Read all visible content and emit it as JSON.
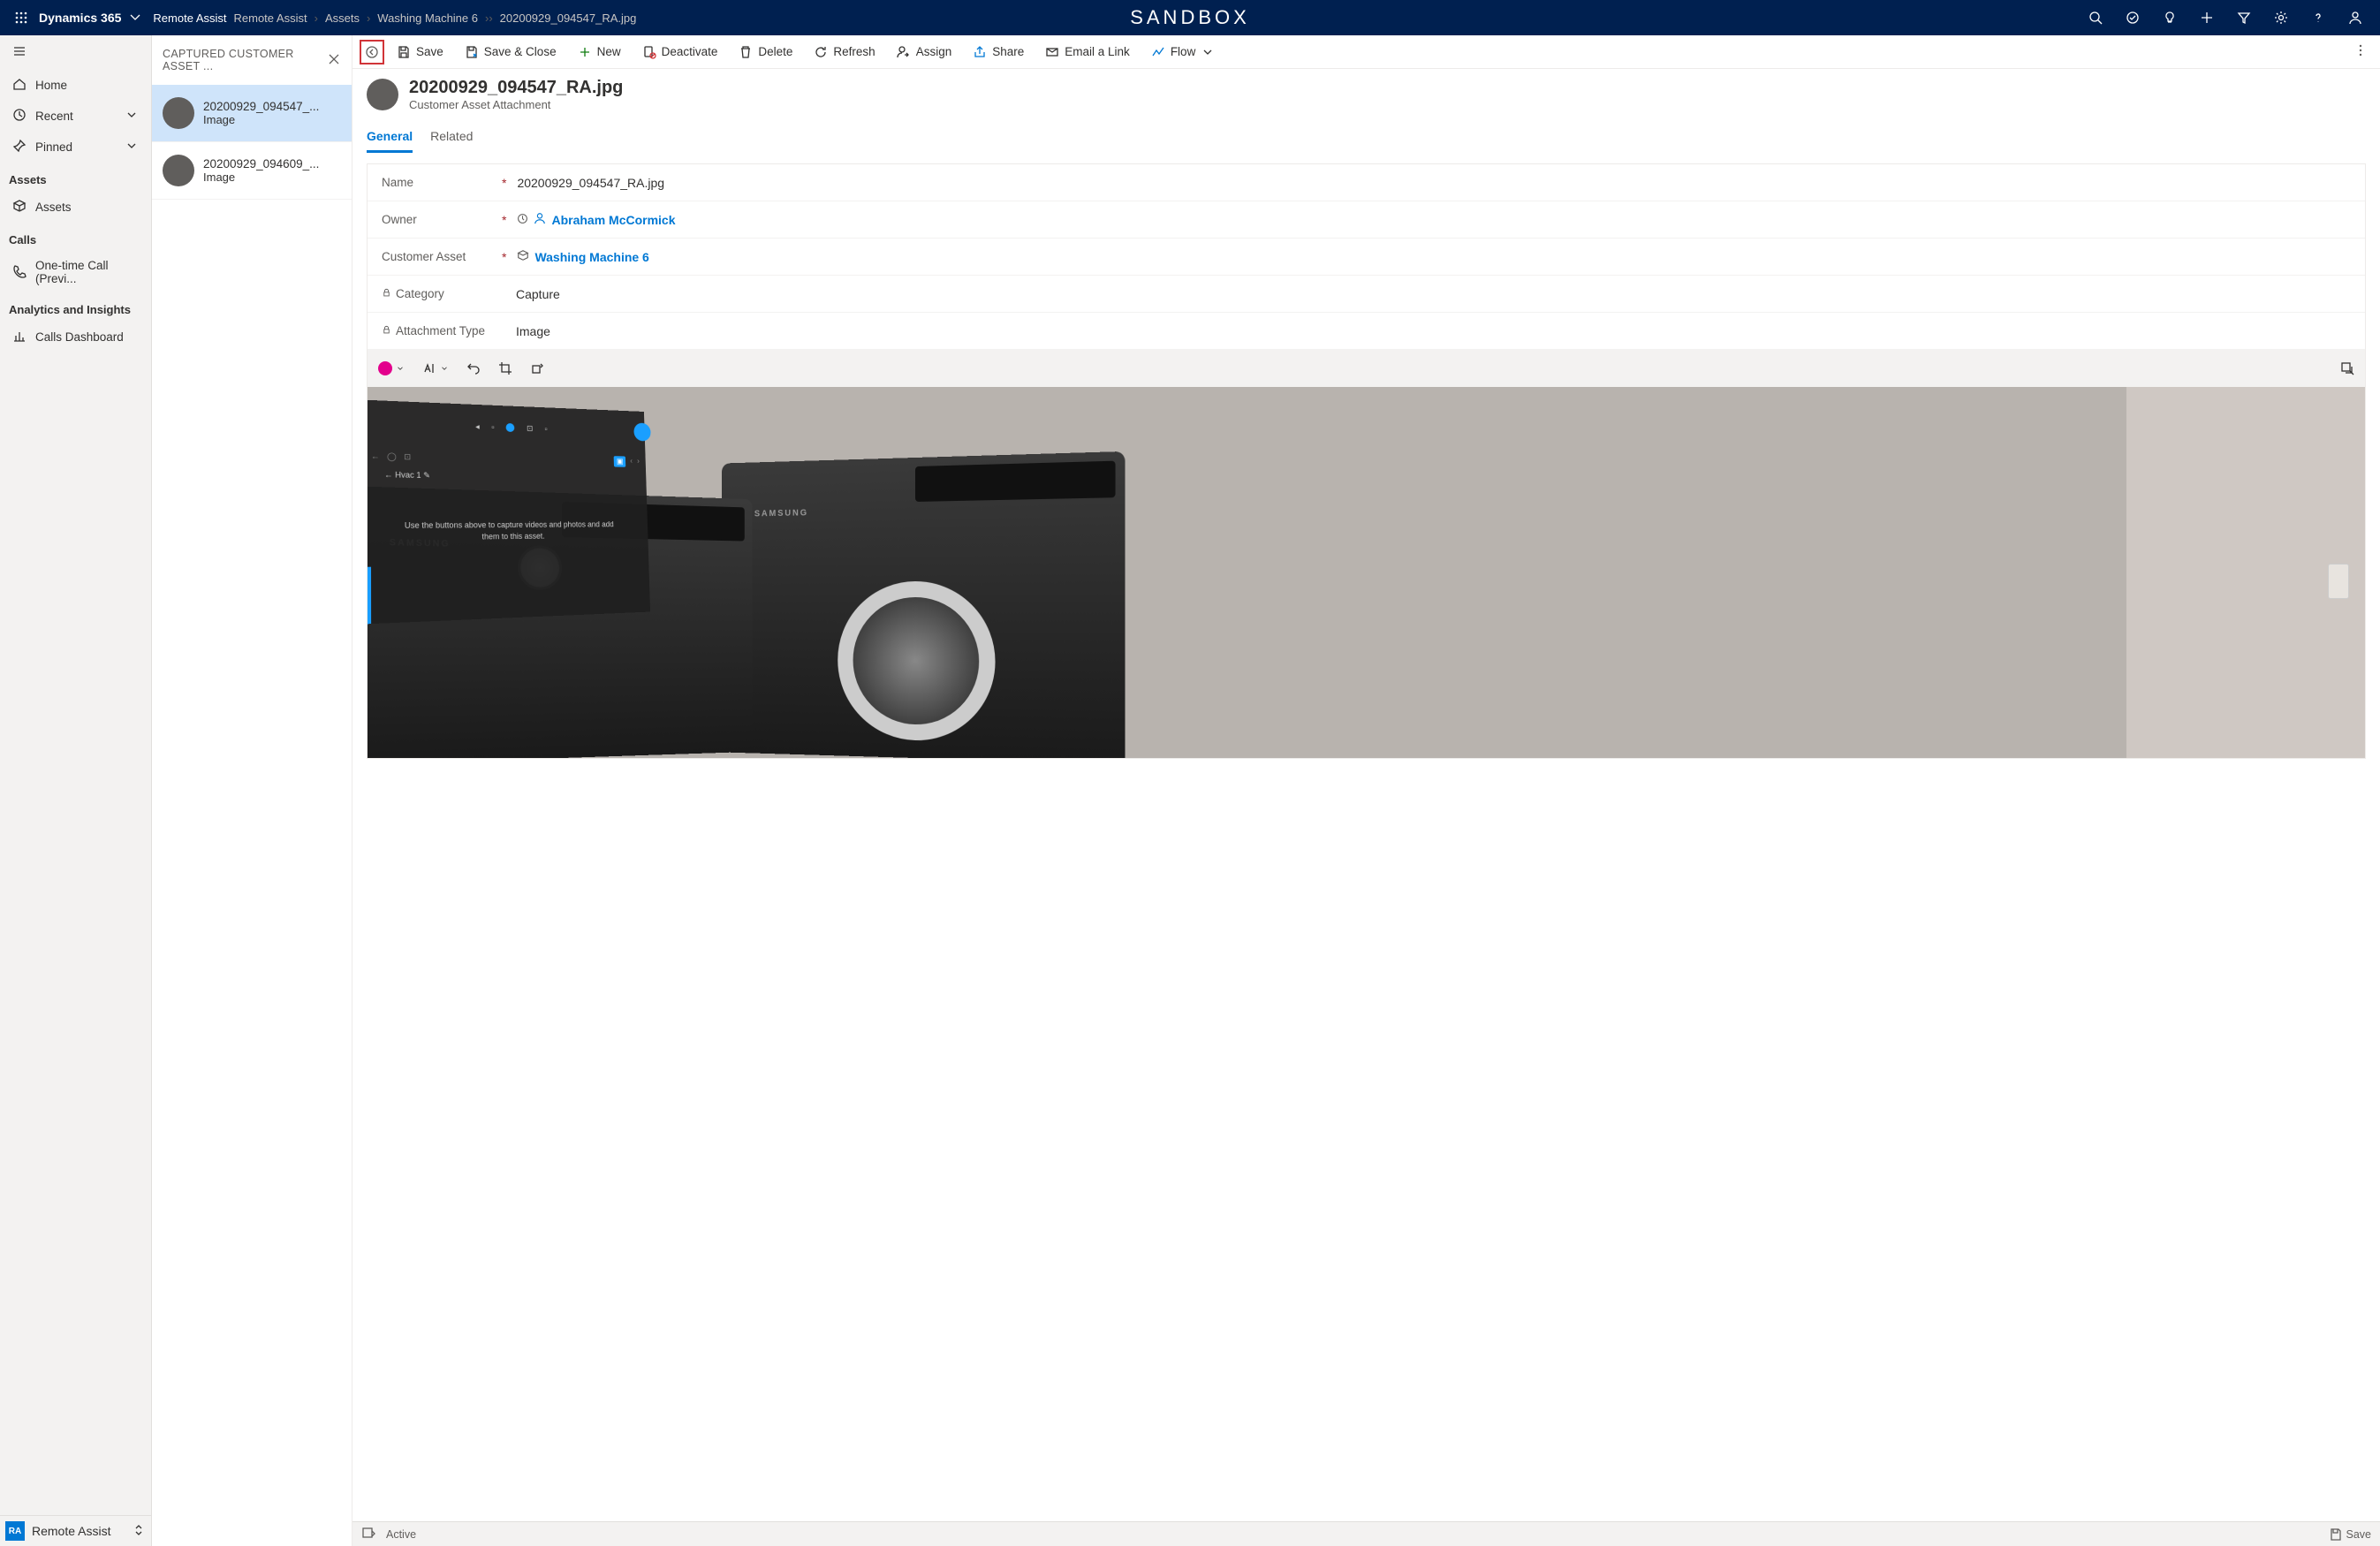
{
  "topnav": {
    "app": "Dynamics 365",
    "breadcrumb": [
      "Remote Assist",
      "Remote Assist",
      "Assets",
      "Washing Machine 6",
      "20200929_094547_RA.jpg"
    ],
    "sandbox": "SANDBOX"
  },
  "leftnav": {
    "home": "Home",
    "recent": "Recent",
    "pinned": "Pinned",
    "sections": {
      "assets": {
        "label": "Assets",
        "items": [
          "Assets"
        ]
      },
      "calls": {
        "label": "Calls",
        "items": [
          "One-time Call (Previ..."
        ]
      },
      "analytics": {
        "label": "Analytics and Insights",
        "items": [
          "Calls Dashboard"
        ]
      }
    },
    "app_switcher": {
      "badge": "RA",
      "label": "Remote Assist"
    }
  },
  "listpane": {
    "header": "CAPTURED CUSTOMER ASSET ...",
    "items": [
      {
        "title": "20200929_094547_...",
        "sub": "Image"
      },
      {
        "title": "20200929_094609_...",
        "sub": "Image"
      }
    ]
  },
  "cmdbar": {
    "save": "Save",
    "save_close": "Save & Close",
    "new": "New",
    "deactivate": "Deactivate",
    "delete": "Delete",
    "refresh": "Refresh",
    "assign": "Assign",
    "share": "Share",
    "email_link": "Email a Link",
    "flow": "Flow"
  },
  "record": {
    "title": "20200929_094547_RA.jpg",
    "subtitle": "Customer Asset Attachment",
    "tabs": {
      "general": "General",
      "related": "Related"
    },
    "fields": {
      "name": {
        "label": "Name",
        "value": "20200929_094547_RA.jpg"
      },
      "owner": {
        "label": "Owner",
        "value": "Abraham McCormick"
      },
      "customer_asset": {
        "label": "Customer Asset",
        "value": "Washing Machine 6"
      },
      "category": {
        "label": "Category",
        "value": "Capture"
      },
      "attachment_type": {
        "label": "Attachment Type",
        "value": "Image"
      }
    }
  },
  "image_hud": {
    "label": "Hvac 1",
    "text": "Use the buttons above to capture videos and photos and add them to this asset."
  },
  "washer_brand": "SAMSUNG",
  "statusbar": {
    "status": "Active",
    "save": "Save"
  }
}
